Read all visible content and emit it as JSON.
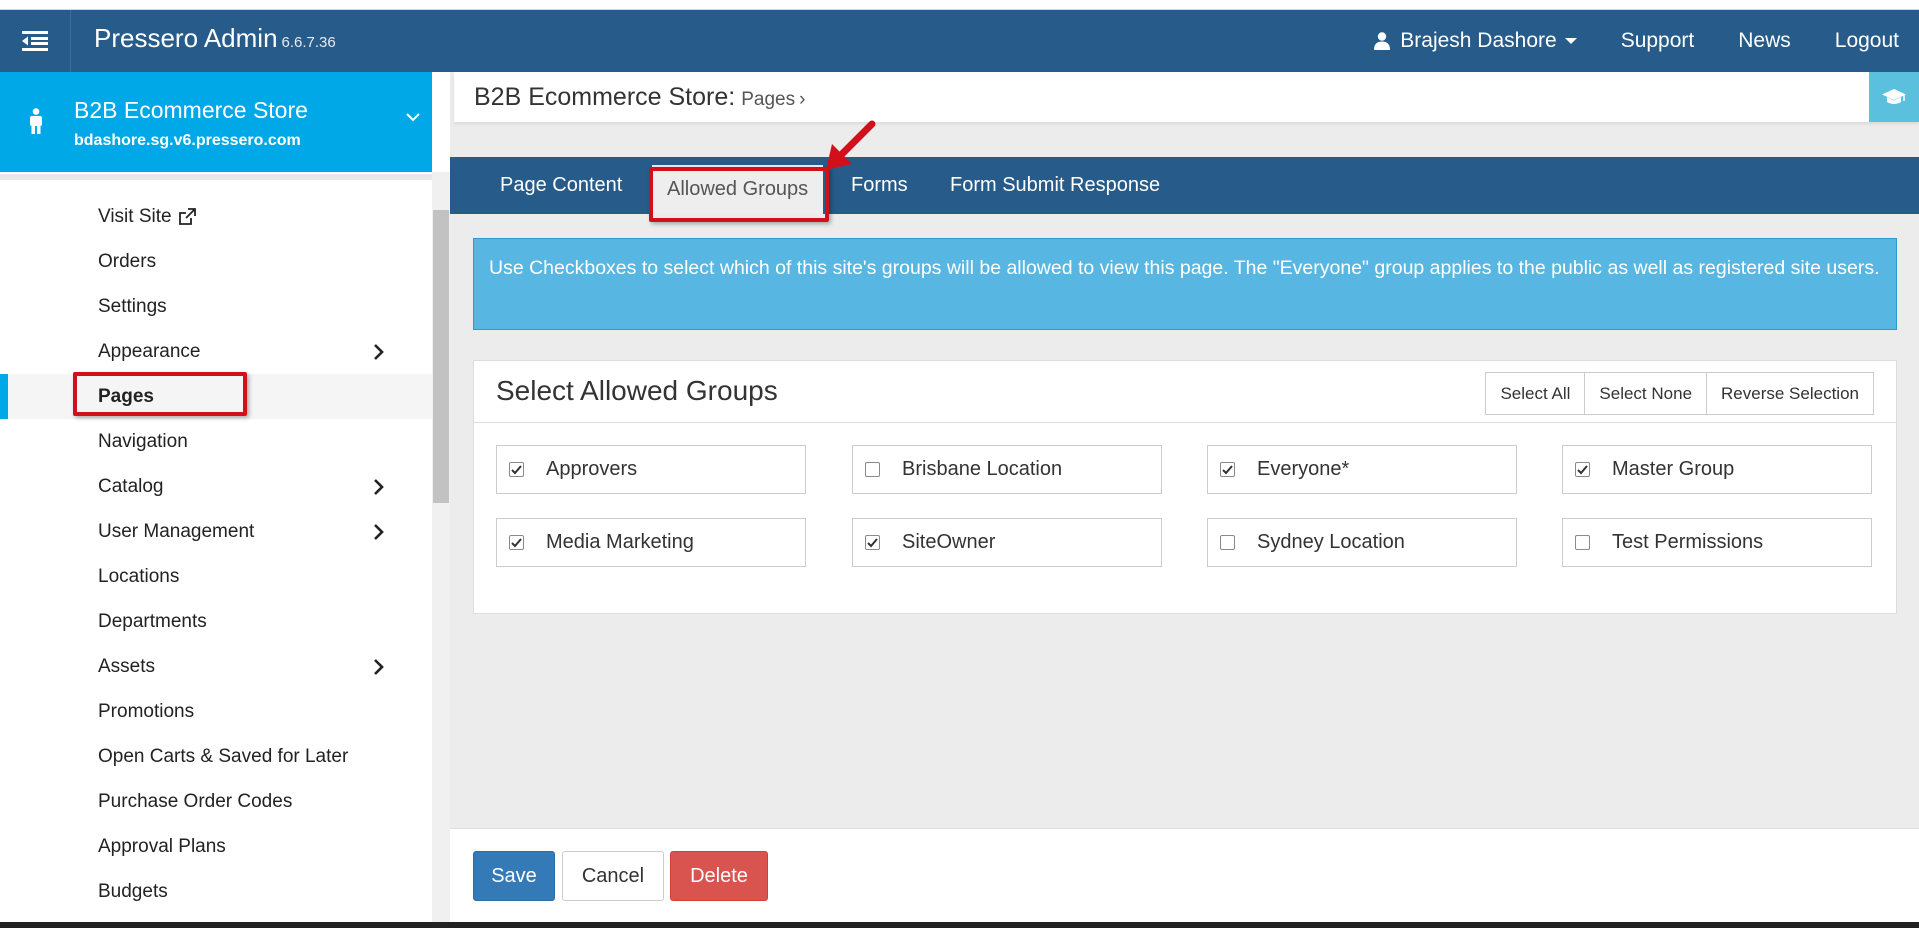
{
  "header": {
    "app_title": "Pressero Admin",
    "version": "6.6.7.36",
    "user_name": "Brajesh Dashore",
    "links": [
      "Support",
      "News",
      "Logout"
    ]
  },
  "store": {
    "name": "B2B Ecommerce Store",
    "url": "bdashore.sg.v6.pressero.com"
  },
  "sidebar": {
    "items": [
      {
        "label": "Visit Site",
        "has_submenu": false,
        "external": true
      },
      {
        "label": "Orders",
        "has_submenu": false
      },
      {
        "label": "Settings",
        "has_submenu": false
      },
      {
        "label": "Appearance",
        "has_submenu": true
      },
      {
        "label": "Pages",
        "has_submenu": false,
        "active": true
      },
      {
        "label": "Navigation",
        "has_submenu": false
      },
      {
        "label": "Catalog",
        "has_submenu": true
      },
      {
        "label": "User Management",
        "has_submenu": true
      },
      {
        "label": "Locations",
        "has_submenu": false
      },
      {
        "label": "Departments",
        "has_submenu": false
      },
      {
        "label": "Assets",
        "has_submenu": true
      },
      {
        "label": "Promotions",
        "has_submenu": false
      },
      {
        "label": "Open Carts & Saved for Later",
        "has_submenu": false
      },
      {
        "label": "Purchase Order Codes",
        "has_submenu": false
      },
      {
        "label": "Approval Plans",
        "has_submenu": false
      },
      {
        "label": "Budgets",
        "has_submenu": false
      }
    ]
  },
  "breadcrumb": {
    "store": "B2B Ecommerce Store:",
    "section": "Pages",
    "arrow": "›"
  },
  "tabs": [
    {
      "label": "Page Content",
      "active": false
    },
    {
      "label": "Allowed Groups",
      "active": true
    },
    {
      "label": "Forms",
      "active": false
    },
    {
      "label": "Form Submit Response",
      "active": false
    }
  ],
  "info_message": "Use Checkboxes to select which of this site's groups will be allowed to view this page. The \"Everyone\" group applies to the public as well as registered site users.",
  "groups_panel": {
    "title": "Select Allowed Groups",
    "buttons": [
      "Select All",
      "Select None",
      "Reverse Selection"
    ],
    "groups": [
      {
        "name": "Approvers",
        "checked": true
      },
      {
        "name": "Brisbane Location",
        "checked": false
      },
      {
        "name": "Everyone*",
        "checked": true
      },
      {
        "name": "Master Group",
        "checked": true
      },
      {
        "name": "Media Marketing",
        "checked": true
      },
      {
        "name": "SiteOwner",
        "checked": true
      },
      {
        "name": "Sydney Location",
        "checked": false
      },
      {
        "name": "Test Permissions",
        "checked": false
      }
    ]
  },
  "footer": {
    "save": "Save",
    "cancel": "Cancel",
    "delete": "Delete"
  },
  "colors": {
    "nav_bg": "#275b89",
    "store_header_bg": "#00a8e8",
    "info_bg": "#58b6e3",
    "highlight": "#d1101b",
    "save_btn": "#337ab7",
    "delete_btn": "#d9534f"
  }
}
